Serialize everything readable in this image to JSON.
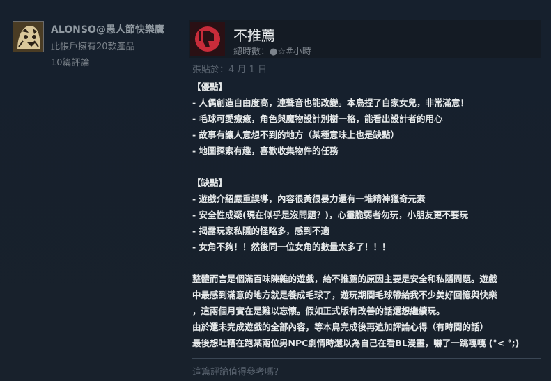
{
  "author": {
    "name": "ALONSO@愚人節快樂鷹",
    "owned": "此帳戶擁有20款產品",
    "reviews": "10篇評論"
  },
  "vote": {
    "title": "不推薦",
    "playtime": "總時數：●☆#小時",
    "icon": "thumbs-down-icon",
    "accent": "#c82c3a"
  },
  "posted": "張貼於：4 月 1 日",
  "review_lines": [
    "【優點】",
    "- 人偶創造自由度高，連聲音也能改變。本鳥捏了自家女兒，非常滿意！",
    "- 毛球可愛療癒，角色與魔物設計別樹一格，能看出設計者的用心",
    "- 故事有讓人意想不到的地方（某種意味上也是缺點）",
    "- 地圖探索有趣，喜歡收集物件的任務",
    "",
    "【缺點】",
    "- 遊戲介紹嚴重誤導，內容很黃很暴力還有一堆精神獵奇元素",
    "- 安全性成疑(現在似乎是沒問題？)，心靈脆弱者勿玩，小朋友更不要玩",
    "- 揭露玩家私隱的怪略多，感到不適",
    "- 女角不夠！！然後同一位女角的數量太多了！！！",
    "",
    "整體而言是個滿百味陳雜的遊戲，給不推薦的原因主要是安全和私隱問題。遊戲",
    "中最感到滿意的地方就是養成毛球了，遊玩期間毛球帶給我不少美好回憶與快樂",
    "，這兩個月實在是難以忘懷。假如正式版有改善的話還想繼續玩。",
    "由於還未完成遊戲的全部內容，等本鳥完成後再追加評論心得（有時間的話）",
    "最後想吐糟在跑某兩位男NPC劇情時還以為自己在看BL漫畫，嚇了一跳嘎嘎 (°< °;)"
  ],
  "helpful_prompt": "這篇評論值得參考嗎？"
}
